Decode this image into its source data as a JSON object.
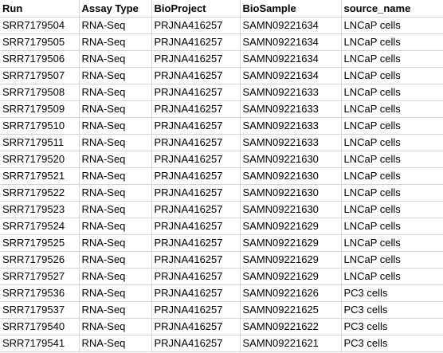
{
  "table": {
    "headers": [
      "Run",
      "Assay Type",
      "BioProject",
      "BioSample",
      "source_name"
    ],
    "rows": [
      [
        "SRR7179504",
        "RNA-Seq",
        "PRJNA416257",
        "SAMN09221634",
        "LNCaP cells"
      ],
      [
        "SRR7179505",
        "RNA-Seq",
        "PRJNA416257",
        "SAMN09221634",
        "LNCaP cells"
      ],
      [
        "SRR7179506",
        "RNA-Seq",
        "PRJNA416257",
        "SAMN09221634",
        "LNCaP cells"
      ],
      [
        "SRR7179507",
        "RNA-Seq",
        "PRJNA416257",
        "SAMN09221634",
        "LNCaP cells"
      ],
      [
        "SRR7179508",
        "RNA-Seq",
        "PRJNA416257",
        "SAMN09221633",
        "LNCaP cells"
      ],
      [
        "SRR7179509",
        "RNA-Seq",
        "PRJNA416257",
        "SAMN09221633",
        "LNCaP cells"
      ],
      [
        "SRR7179510",
        "RNA-Seq",
        "PRJNA416257",
        "SAMN09221633",
        "LNCaP cells"
      ],
      [
        "SRR7179511",
        "RNA-Seq",
        "PRJNA416257",
        "SAMN09221633",
        "LNCaP cells"
      ],
      [
        "SRR7179520",
        "RNA-Seq",
        "PRJNA416257",
        "SAMN09221630",
        "LNCaP cells"
      ],
      [
        "SRR7179521",
        "RNA-Seq",
        "PRJNA416257",
        "SAMN09221630",
        "LNCaP cells"
      ],
      [
        "SRR7179522",
        "RNA-Seq",
        "PRJNA416257",
        "SAMN09221630",
        "LNCaP cells"
      ],
      [
        "SRR7179523",
        "RNA-Seq",
        "PRJNA416257",
        "SAMN09221630",
        "LNCaP cells"
      ],
      [
        "SRR7179524",
        "RNA-Seq",
        "PRJNA416257",
        "SAMN09221629",
        "LNCaP cells"
      ],
      [
        "SRR7179525",
        "RNA-Seq",
        "PRJNA416257",
        "SAMN09221629",
        "LNCaP cells"
      ],
      [
        "SRR7179526",
        "RNA-Seq",
        "PRJNA416257",
        "SAMN09221629",
        "LNCaP cells"
      ],
      [
        "SRR7179527",
        "RNA-Seq",
        "PRJNA416257",
        "SAMN09221629",
        "LNCaP cells"
      ],
      [
        "SRR7179536",
        "RNA-Seq",
        "PRJNA416257",
        "SAMN09221626",
        "PC3 cells"
      ],
      [
        "SRR7179537",
        "RNA-Seq",
        "PRJNA416257",
        "SAMN09221625",
        "PC3 cells"
      ],
      [
        "SRR7179540",
        "RNA-Seq",
        "PRJNA416257",
        "SAMN09221622",
        "PC3 cells"
      ],
      [
        "SRR7179541",
        "RNA-Seq",
        "PRJNA416257",
        "SAMN09221621",
        "PC3 cells"
      ]
    ]
  },
  "colors": {
    "gridline": "#d4d4d4",
    "text": "#000000",
    "background": "#ffffff"
  }
}
